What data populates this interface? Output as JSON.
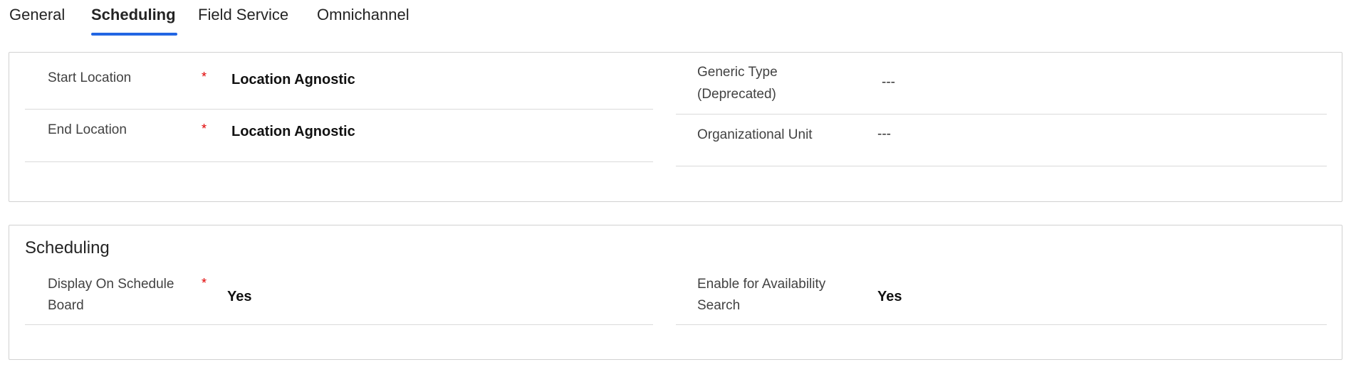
{
  "tabs": [
    {
      "label": "General"
    },
    {
      "label": "Scheduling"
    },
    {
      "label": "Field Service"
    },
    {
      "label": "Omnichannel"
    }
  ],
  "active_tab": "Scheduling",
  "section1": {
    "fields": {
      "start_location": {
        "label": "Start Location",
        "required": "*",
        "value": "Location Agnostic"
      },
      "end_location": {
        "label": "End Location",
        "required": "*",
        "value": "Location Agnostic"
      },
      "generic_type": {
        "label_line1": "Generic Type",
        "label_line2": "(Deprecated)",
        "value": "---"
      },
      "org_unit": {
        "label": "Organizational Unit",
        "value": "---"
      }
    }
  },
  "section2": {
    "title": "Scheduling",
    "fields": {
      "display_on_board": {
        "label_line1": "Display On Schedule",
        "label_line2": "Board",
        "required": "*",
        "value": "Yes"
      },
      "availability_search": {
        "label_line1": "Enable for Availability",
        "label_line2": "Search",
        "value": "Yes"
      }
    }
  },
  "colors": {
    "accent": "#2266e3",
    "required": "#e00000"
  }
}
